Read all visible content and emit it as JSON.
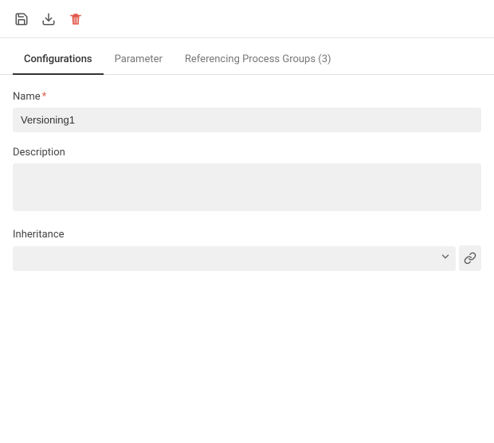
{
  "toolbar": {
    "save_icon": "save",
    "download_icon": "download",
    "delete_icon": "delete"
  },
  "tabs": [
    {
      "id": "configurations",
      "label": "Configurations",
      "active": true
    },
    {
      "id": "parameter",
      "label": "Parameter",
      "active": false
    },
    {
      "id": "referencing-process-groups",
      "label": "Referencing Process Groups (3)",
      "active": false
    }
  ],
  "fields": {
    "name_label": "Name",
    "name_required": "*",
    "name_value": "Versioning1",
    "description_label": "Description",
    "description_value": "",
    "inheritance_label": "Inheritance",
    "inheritance_value": "",
    "inheritance_placeholder": ""
  }
}
